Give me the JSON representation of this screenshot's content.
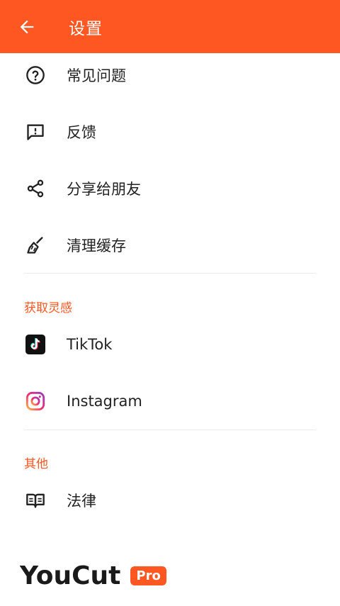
{
  "header": {
    "title": "设置",
    "back_icon": "arrow-left-icon",
    "bg_color": "#ff5722"
  },
  "menu": [
    {
      "label": "常见问题",
      "icon": "help-circle-icon"
    },
    {
      "label": "反馈",
      "icon": "feedback-icon"
    },
    {
      "label": "分享给朋友",
      "icon": "share-icon"
    },
    {
      "label": "清理缓存",
      "icon": "broom-icon"
    }
  ],
  "inspiration": {
    "title": "获取灵感",
    "items": [
      {
        "label": "TikTok",
        "icon": "tiktok-icon"
      },
      {
        "label": "Instagram",
        "icon": "instagram-icon"
      }
    ]
  },
  "other": {
    "title": "其他",
    "items": [
      {
        "label": "法律",
        "icon": "book-icon"
      }
    ]
  },
  "brand": {
    "name": "YouCut",
    "badge": "Pro"
  },
  "accent_color": "#ff5722"
}
